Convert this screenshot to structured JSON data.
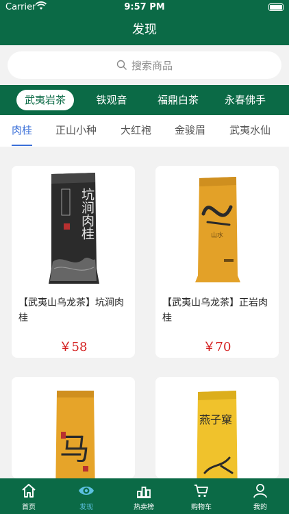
{
  "status_bar": {
    "carrier": "Carrier",
    "time": "9:57 PM"
  },
  "nav": {
    "title": "发现"
  },
  "search": {
    "placeholder": "搜索商品"
  },
  "categories": [
    "武夷岩茶",
    "铁观音",
    "福鼎白茶",
    "永春佛手"
  ],
  "subcategories": [
    "肉桂",
    "正山小种",
    "大红袍",
    "金骏眉",
    "武夷水仙"
  ],
  "products": [
    {
      "name": "【武夷山乌龙茶】坑涧肉桂",
      "price": "￥58",
      "bag_text": "坑涧肉桂"
    },
    {
      "name": "【武夷山乌龙茶】正岩肉桂",
      "price": "￥70",
      "bag_text": "山水"
    },
    {
      "name": "",
      "price": "",
      "bag_text": "马"
    },
    {
      "name": "",
      "price": "",
      "bag_text": "燕子窠"
    }
  ],
  "tabbar": [
    {
      "label": "首页",
      "icon": "home-icon"
    },
    {
      "label": "发现",
      "icon": "eye-icon"
    },
    {
      "label": "热卖榜",
      "icon": "chart-icon"
    },
    {
      "label": "购物车",
      "icon": "cart-icon"
    },
    {
      "label": "我的",
      "icon": "user-icon"
    }
  ],
  "colors": {
    "primary": "#0b6a46",
    "active_blue": "#3a6fd8",
    "price_red": "#d42020",
    "tab_active": "#5cc0e0"
  }
}
